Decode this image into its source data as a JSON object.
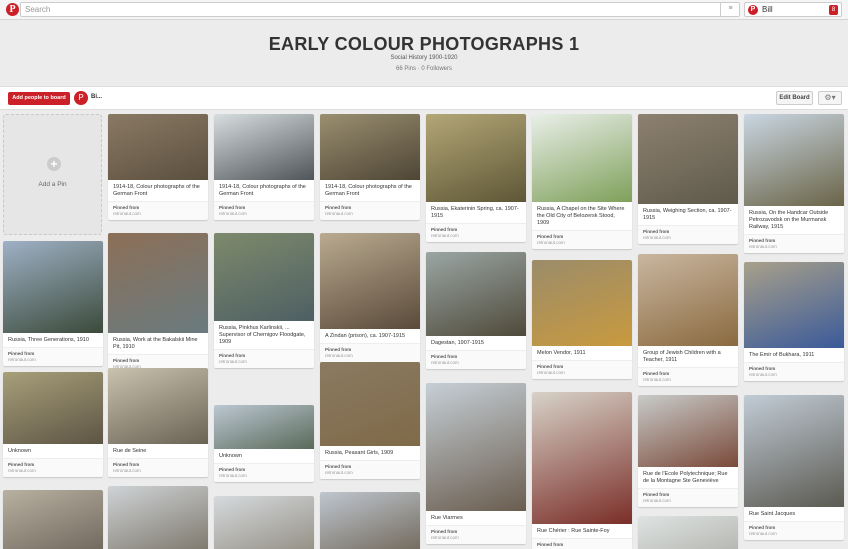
{
  "topbar": {
    "logo": "P",
    "search_placeholder": "Search",
    "menu_icon": "≡",
    "user": "Bill",
    "notifications": "8"
  },
  "board": {
    "title": "EARLY COLOUR PHOTOGRAPHS 1",
    "description": "Social History 1900-1920",
    "stats": "66 Pins · 0 Followers",
    "add_people_label": "Add people to board",
    "collaborator": "Bi...",
    "edit_label": "Edit Board"
  },
  "add_pin_label": "Add a Pin",
  "pinned_from": "Pinned from",
  "pins": [
    {
      "desc": "1914-18, Colour photographs of the German Front",
      "src": "retronaut.com",
      "c1": "#8a7a64",
      "c2": "#5b4f3e"
    },
    {
      "desc": "1914-18, Colour photographs of the German Front",
      "src": "retronaut.com",
      "c1": "#d8dde0",
      "c2": "#4f5558"
    },
    {
      "desc": "1914-18, Colour photographs of the German Front",
      "src": "retronaut.com",
      "c1": "#9a8f70",
      "c2": "#4e4535"
    },
    {
      "desc": "Russia, Ekaterinin Spring, ca. 1907-1915",
      "src": "retronaut.com",
      "c1": "#b3a777",
      "c2": "#5e5636"
    },
    {
      "desc": "Russia, A Chapel on the Site Where the Old City of Belozersk Stood, 1909",
      "src": "retronaut.com",
      "c1": "#e9efe9",
      "c2": "#7fa05a"
    },
    {
      "desc": "Russia, Weighing Section, ca. 1907-1915",
      "src": "retronaut.com",
      "c1": "#8d8170",
      "c2": "#5f5a4b"
    },
    {
      "desc": "Russia, On the Handcar Outside Petrozavodsk on the Murmansk Railway, 1915",
      "src": "retronaut.com",
      "c1": "#c9d6e2",
      "c2": "#6a6447"
    },
    {
      "desc": "Russia, Three Generations, 1910",
      "src": "retronaut.com",
      "c1": "#9fb1c6",
      "c2": "#3b4a3a"
    },
    {
      "desc": "Russia, Work at the Bakalskii Mine Pit, 1910",
      "src": "retronaut.com",
      "c1": "#8c6f57",
      "c2": "#6a7b7f"
    },
    {
      "desc": "Russia, Pinkhus Karlinskii, ... Supervisor of Chernigov Floodgate, 1909",
      "src": "retronaut.com",
      "c1": "#7d8a6c",
      "c2": "#4e5f63"
    },
    {
      "desc": "A Zindan (prison), ca. 1907-1915",
      "src": "retronaut.com",
      "c1": "#b9aa90",
      "c2": "#5a4a3a"
    },
    {
      "desc": "Dagestan, 1907-1915",
      "src": "retronaut.com",
      "c1": "#9aa6a4",
      "c2": "#4f4a3a"
    },
    {
      "desc": "Melon Vendor, 1911",
      "src": "retronaut.com",
      "c1": "#9b8c6a",
      "c2": "#c99a3e"
    },
    {
      "desc": "Group of Jewish Children with a Teacher, 1911",
      "src": "retronaut.com",
      "c1": "#c9b6a0",
      "c2": "#8a6a3f"
    },
    {
      "desc": "The Emir of Bukhara, 1911",
      "src": "retronaut.com",
      "c1": "#a8a08a",
      "c2": "#3a5a9a"
    },
    {
      "desc": "Unknown",
      "src": "retronaut.com",
      "c1": "#a89f7a",
      "c2": "#5d5544"
    },
    {
      "desc": "Rue de Seine",
      "src": "retronaut.com",
      "c1": "#c9c2ae",
      "c2": "#6a6254"
    },
    {
      "desc": "Unknown",
      "src": "retronaut.com",
      "c1": "#bcc7d2",
      "c2": "#5a6a5a"
    },
    {
      "desc": "Russia, Peasant Girls, 1909",
      "src": "retronaut.com",
      "c1": "#8b7a62",
      "c2": "#7f6a48"
    },
    {
      "desc": "Rue Viarmes",
      "src": "retronaut.com",
      "c1": "#c6cfd6",
      "c2": "#6a5d4f"
    },
    {
      "desc": "Rue Chérier : Rue Sainte-Foy",
      "src": "retronaut.com",
      "c1": "#d7d2c8",
      "c2": "#7a2e28"
    },
    {
      "desc": "Rue de l'Ecole Polytechnique; Rue de la Montagne Ste Geneviève",
      "src": "retronaut.com",
      "c1": "#c9cbc9",
      "c2": "#7a4a3a"
    },
    {
      "desc": "Rue Saint Jacques",
      "src": "retronaut.com",
      "c1": "#c2ccd6",
      "c2": "#5b5a52"
    },
    {
      "desc": "",
      "src": "",
      "c1": "#b8b0a0",
      "c2": "#6a6258"
    },
    {
      "desc": "",
      "src": "",
      "c1": "#cfd3d6",
      "c2": "#7a7468"
    },
    {
      "desc": "",
      "src": "",
      "c1": "#d6dadd",
      "c2": "#8a8478"
    },
    {
      "desc": "",
      "src": "",
      "c1": "#bfc6cf",
      "c2": "#6a6050"
    },
    {
      "desc": "",
      "src": "",
      "c1": "#dfe3e2",
      "c2": "#a6a8a0"
    }
  ]
}
